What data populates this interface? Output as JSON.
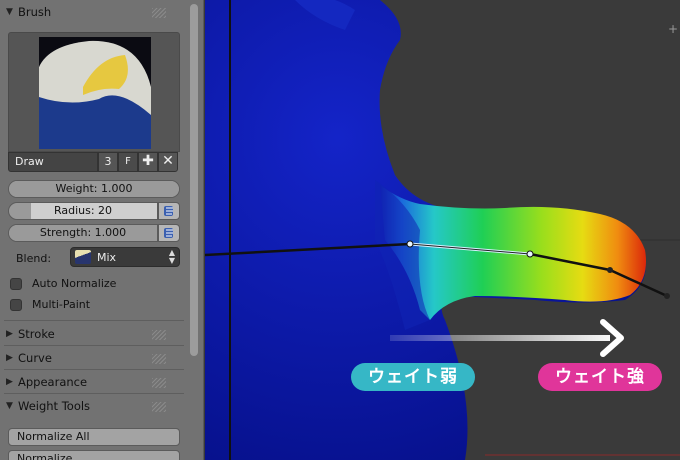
{
  "panel": {
    "brush": {
      "title": "Brush",
      "name": "Draw",
      "users": "3",
      "fake_user": "F",
      "add_icon": "plus-icon",
      "remove_icon": "x-icon"
    },
    "weight": {
      "label": "Weight: 1.000",
      "value": 1.0
    },
    "radius": {
      "label": "Radius: 20",
      "value": 20,
      "icon": "pressure-icon"
    },
    "strength": {
      "label": "Strength: 1.000",
      "value": 1.0,
      "icon": "pressure-icon"
    },
    "blend": {
      "label": "Blend:",
      "value": "Mix"
    },
    "auto_normalize": {
      "label": "Auto Normalize",
      "checked": false
    },
    "multi_paint": {
      "label": "Multi-Paint",
      "checked": false
    },
    "sections": [
      {
        "label": "Stroke",
        "expanded": false
      },
      {
        "label": "Curve",
        "expanded": false
      },
      {
        "label": "Appearance",
        "expanded": false
      },
      {
        "label": "Weight Tools",
        "expanded": true
      }
    ],
    "buttons": {
      "normalize_all": "Normalize All",
      "normalize": "Normalize"
    }
  },
  "viewport": {
    "arrow_label_weak": "ウェイト弱",
    "arrow_label_strong": "ウェイト強",
    "colors": {
      "mesh_blue": "#0a1aa8",
      "weak_pill": "#36b7c6",
      "strong_pill": "#e0359a",
      "background": "#3a3a3a"
    }
  }
}
